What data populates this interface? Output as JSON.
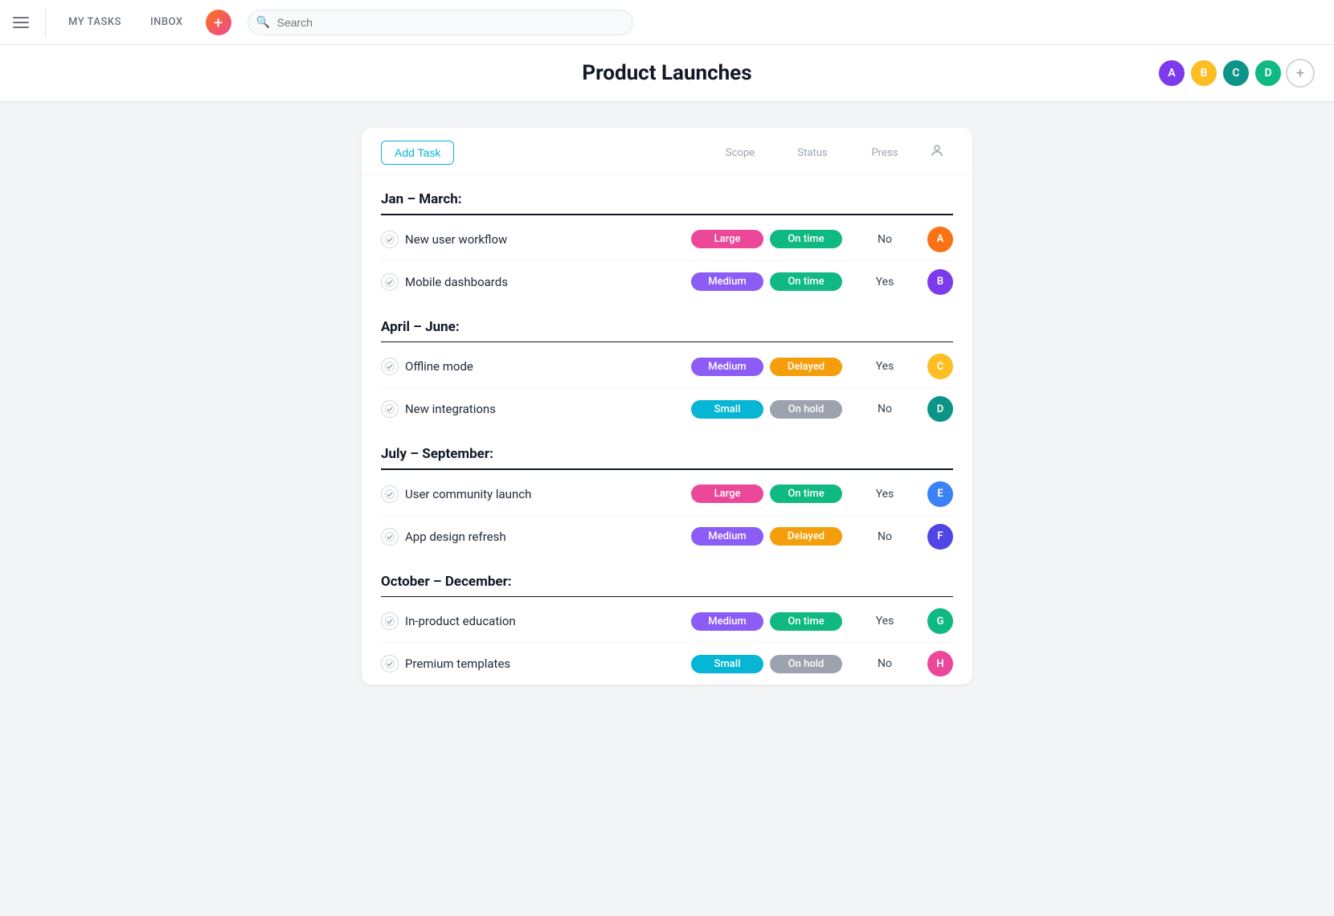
{
  "nav": {
    "mytasks_label": "MY TASKS",
    "inbox_label": "INBOX",
    "search_placeholder": "Search",
    "add_btn_label": "+"
  },
  "page": {
    "title": "Product Launches"
  },
  "header_avatars": [
    {
      "id": "av1",
      "initials": "A",
      "color_class": "hav-purple"
    },
    {
      "id": "av2",
      "initials": "B",
      "color_class": "hav-yellow"
    },
    {
      "id": "av3",
      "initials": "C",
      "color_class": "hav-teal"
    },
    {
      "id": "av4",
      "initials": "D",
      "color_class": "hav-green"
    }
  ],
  "toolbar": {
    "add_task_label": "Add Task",
    "col_scope": "Scope",
    "col_status": "Status",
    "col_press": "Press"
  },
  "sections": [
    {
      "id": "jan-march",
      "title": "Jan – March:",
      "tasks": [
        {
          "id": "t1",
          "name": "New user workflow",
          "scope": "Large",
          "scope_class": "badge-large",
          "status": "On time",
          "status_class": "badge-ontime",
          "press": "No",
          "avatar_class": "av-orange",
          "avatar_initials": "A"
        },
        {
          "id": "t2",
          "name": "Mobile dashboards",
          "scope": "Medium",
          "scope_class": "badge-medium",
          "status": "On time",
          "status_class": "badge-ontime",
          "press": "Yes",
          "avatar_class": "av-purple",
          "avatar_initials": "B"
        }
      ]
    },
    {
      "id": "april-june",
      "title": "April – June:",
      "tasks": [
        {
          "id": "t3",
          "name": "Offline mode",
          "scope": "Medium",
          "scope_class": "badge-medium",
          "status": "Delayed",
          "status_class": "badge-delayed",
          "press": "Yes",
          "avatar_class": "av-yellow",
          "avatar_initials": "C"
        },
        {
          "id": "t4",
          "name": "New integrations",
          "scope": "Small",
          "scope_class": "badge-small",
          "status": "On hold",
          "status_class": "badge-onhold",
          "press": "No",
          "avatar_class": "av-teal",
          "avatar_initials": "D"
        }
      ]
    },
    {
      "id": "july-september",
      "title": "July – September:",
      "tasks": [
        {
          "id": "t5",
          "name": "User community launch",
          "scope": "Large",
          "scope_class": "badge-large",
          "status": "On time",
          "status_class": "badge-ontime",
          "press": "Yes",
          "avatar_class": "av-blue",
          "avatar_initials": "E"
        },
        {
          "id": "t6",
          "name": "App design refresh",
          "scope": "Medium",
          "scope_class": "badge-medium",
          "status": "Delayed",
          "status_class": "badge-delayed",
          "press": "No",
          "avatar_class": "av-indigo",
          "avatar_initials": "F"
        }
      ]
    },
    {
      "id": "october-december",
      "title": "October – December:",
      "tasks": [
        {
          "id": "t7",
          "name": "In-product education",
          "scope": "Medium",
          "scope_class": "badge-medium",
          "status": "On time",
          "status_class": "badge-ontime",
          "press": "Yes",
          "avatar_class": "av-green",
          "avatar_initials": "G"
        },
        {
          "id": "t8",
          "name": "Premium templates",
          "scope": "Small",
          "scope_class": "badge-small",
          "status": "On hold",
          "status_class": "badge-onhold",
          "press": "No",
          "avatar_class": "av-pink",
          "avatar_initials": "H"
        }
      ]
    }
  ]
}
